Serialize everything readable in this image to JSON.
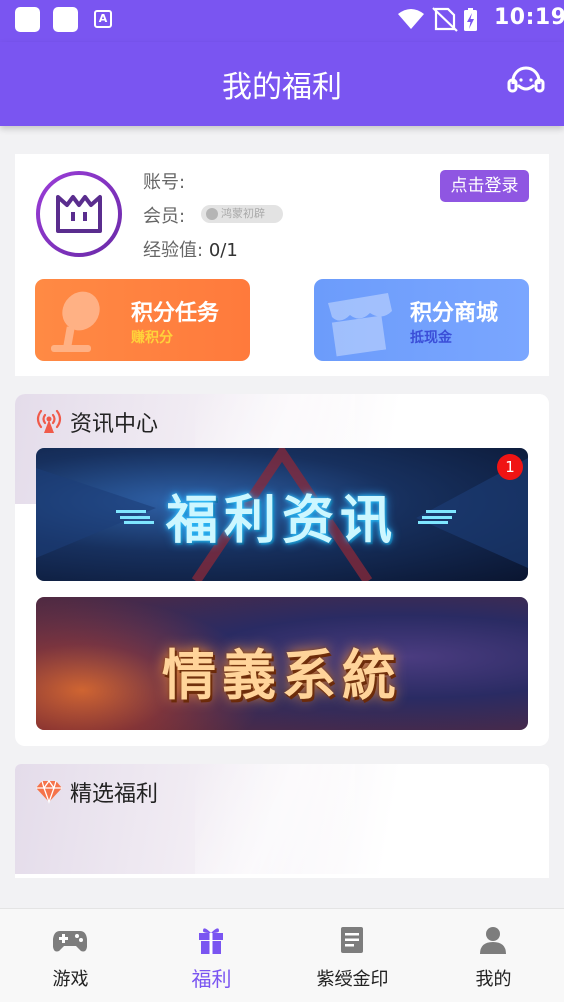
{
  "status_bar": {
    "time": "10:19",
    "app_badge": "A"
  },
  "header": {
    "title": "我的福利"
  },
  "user_card": {
    "account_label": "账号:",
    "member_label": "会员:",
    "member_level": "鸿蒙初辟",
    "exp_label": "经验值:",
    "exp_value": "0/1",
    "login_button": "点击登录",
    "points_task": {
      "title": "积分任务",
      "subtitle": "赚积分"
    },
    "points_mall": {
      "title": "积分商城",
      "subtitle": "抵现金"
    }
  },
  "news_section": {
    "title": "资讯中心",
    "banners": [
      {
        "text": "福利资讯",
        "badge": "1"
      },
      {
        "text": "情義系統"
      }
    ]
  },
  "welfare_section": {
    "title": "精选福利"
  },
  "tab_bar": {
    "active_index": 1,
    "accent_color": "#7a55f1",
    "tabs": [
      {
        "label": "游戏",
        "icon": "gamepad-icon"
      },
      {
        "label": "福利",
        "icon": "gift-icon"
      },
      {
        "label": "紫绶金印",
        "icon": "document-icon"
      },
      {
        "label": "我的",
        "icon": "person-icon"
      }
    ]
  },
  "colors": {
    "brand_purple": "#7a55f1",
    "login_button": "#8f56e2",
    "points_task": "#ff8244",
    "points_mall": "#74a2ff",
    "badge_red": "#f01414"
  }
}
